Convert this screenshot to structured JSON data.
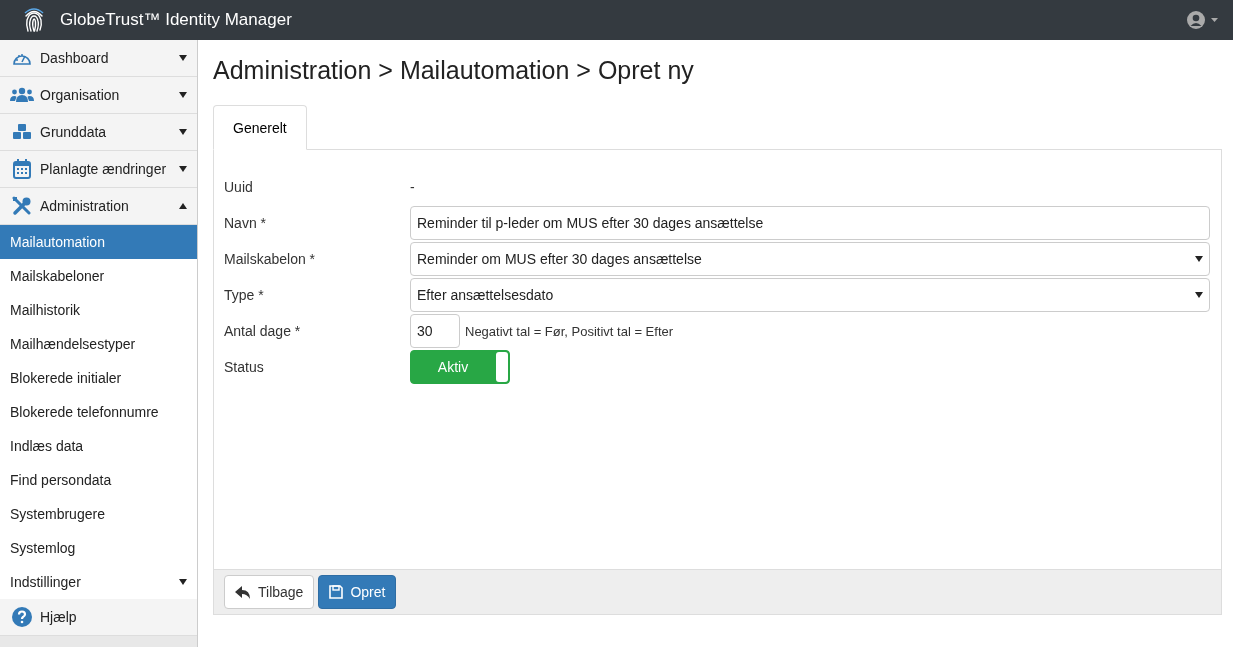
{
  "header": {
    "title": "GlobeTrust™ Identity Manager"
  },
  "sidebar": {
    "items": [
      {
        "label": "Dashboard",
        "expanded": false
      },
      {
        "label": "Organisation",
        "expanded": false
      },
      {
        "label": "Grunddata",
        "expanded": false
      },
      {
        "label": "Planlagte ændringer",
        "expanded": false
      },
      {
        "label": "Administration",
        "expanded": true,
        "children": [
          {
            "label": "Mailautomation",
            "selected": true
          },
          {
            "label": "Mailskabeloner",
            "selected": false
          },
          {
            "label": "Mailhistorik",
            "selected": false
          },
          {
            "label": "Mailhændelsestyper",
            "selected": false
          },
          {
            "label": "Blokerede initialer",
            "selected": false
          },
          {
            "label": "Blokerede telefonnumre",
            "selected": false
          },
          {
            "label": "Indlæs data",
            "selected": false
          },
          {
            "label": "Find persondata",
            "selected": false
          },
          {
            "label": "Systembrugere",
            "selected": false
          },
          {
            "label": "Systemlog",
            "selected": false
          },
          {
            "label": "Indstillinger",
            "selected": false,
            "expanded": false
          }
        ]
      },
      {
        "label": "Hjælp"
      }
    ]
  },
  "page": {
    "title": "Administration > Mailautomation > Opret ny"
  },
  "tabs": [
    {
      "label": "Generelt",
      "selected": true
    }
  ],
  "form": {
    "fields": [
      {
        "kind": "static",
        "label": "Uuid",
        "value": "-"
      },
      {
        "kind": "text",
        "label": "Navn *",
        "value": "Reminder til p-leder om MUS efter 30 dages ansættelse"
      },
      {
        "kind": "select",
        "label": "Mailskabelon *",
        "value": "Reminder om MUS efter 30 dages ansættelse"
      },
      {
        "kind": "select",
        "label": "Type *",
        "value": "Efter ansættelsesdato"
      },
      {
        "kind": "number",
        "label": "Antal dage *",
        "value": "30",
        "hint": "Negativt tal = Før, Positivt tal = Efter"
      },
      {
        "kind": "toggle",
        "label": "Status",
        "value": "Aktiv",
        "on": true
      }
    ]
  },
  "buttons": [
    {
      "kind": "default",
      "label": "Tilbage"
    },
    {
      "kind": "primary",
      "label": "Opret"
    }
  ]
}
